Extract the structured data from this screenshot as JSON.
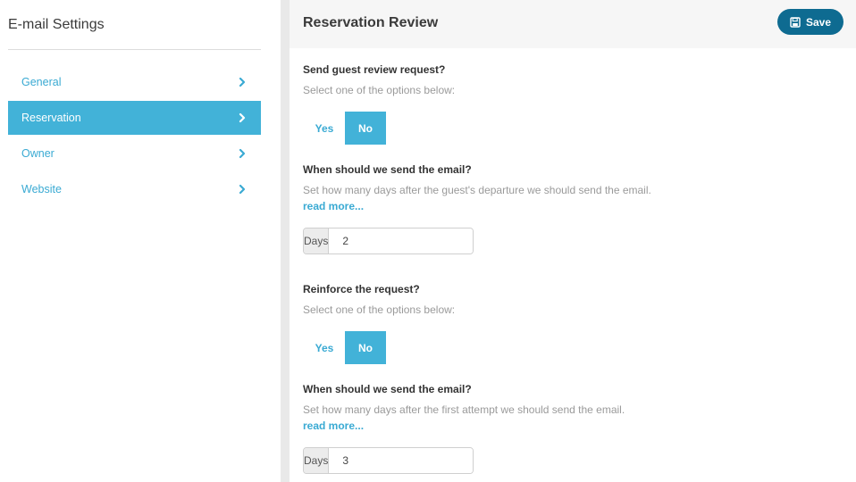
{
  "sidebar": {
    "title": "E-mail Settings",
    "items": [
      {
        "label": "General",
        "active": false
      },
      {
        "label": "Reservation",
        "active": true
      },
      {
        "label": "Owner",
        "active": false
      },
      {
        "label": "Website",
        "active": false
      }
    ]
  },
  "header": {
    "title": "Reservation Review",
    "save_label": "Save"
  },
  "section1": {
    "question": "Send guest review request?",
    "help": "Select one of the options below:",
    "yes_label": "Yes",
    "no_label": "No",
    "selected": "No"
  },
  "section2": {
    "question": "When should we send the email?",
    "help": "Set how many days after the guest's departure we should send the email.",
    "read_more": "read more...",
    "unit_label": "Days",
    "value": "2"
  },
  "section3": {
    "question": "Reinforce the request?",
    "help": "Select one of the options below:",
    "yes_label": "Yes",
    "no_label": "No",
    "selected": "No"
  },
  "section4": {
    "question": "When should we send the email?",
    "help": "Set how many days after the first attempt we should send the email.",
    "read_more": "read more...",
    "unit_label": "Days",
    "value": "3"
  },
  "colors": {
    "accent": "#42b2d8",
    "link": "#3aaad3",
    "save_button": "#0e6b91"
  },
  "icons": {
    "nav_chevron": "chevron-right-icon",
    "save": "floppy-disk-icon"
  }
}
